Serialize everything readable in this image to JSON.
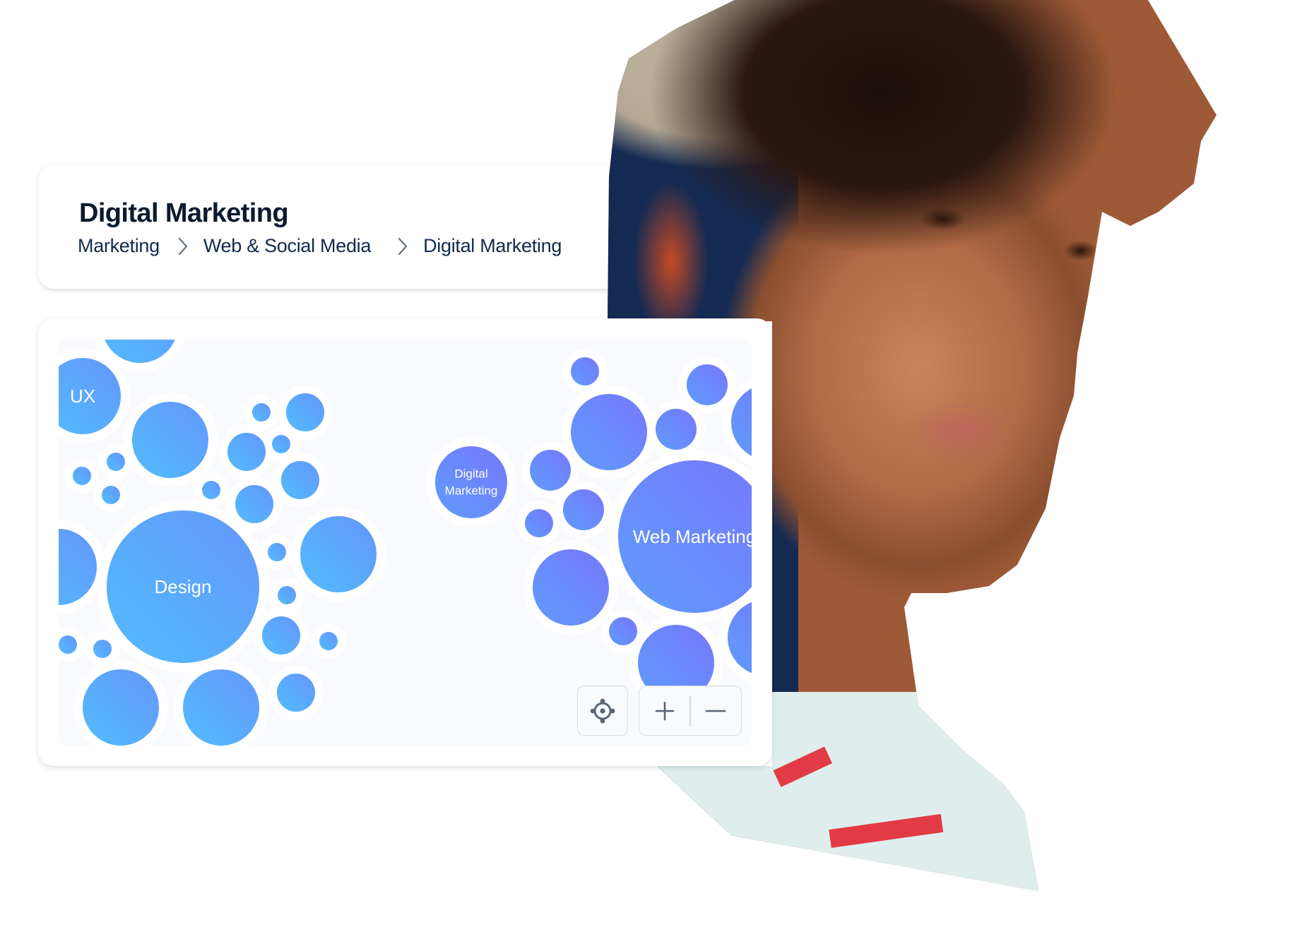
{
  "header": {
    "title": "Digital Marketing",
    "breadcrumb": [
      {
        "label": "Marketing"
      },
      {
        "label": "Web & Social Media"
      },
      {
        "label": "Digital Marketing"
      }
    ],
    "separator_icon": "chevron-right-icon"
  },
  "colors": {
    "title_text": "#0b1a2e",
    "breadcrumb_text": "#102a4c",
    "separator": "#6b7589",
    "chart_background": "#f8fafe",
    "bubble_sky": "#54b7fc",
    "bubble_blue": "#619cfb",
    "bubble_violet": "#7479fb",
    "control_icon": "#5b6577"
  },
  "bubble_map": {
    "clusters": [
      {
        "name": "Design",
        "bubbles": [
          {
            "label": "Design",
            "size": "large",
            "hub": true
          },
          {
            "label": "UX",
            "size": "medium"
          },
          {
            "label": "",
            "size": "medium"
          },
          {
            "label": "",
            "size": "medium"
          },
          {
            "label": "",
            "size": "medium"
          },
          {
            "label": "",
            "size": "medium"
          },
          {
            "label": "",
            "size": "medium"
          },
          {
            "label": "",
            "size": "medium"
          },
          {
            "label": "",
            "size": "small"
          },
          {
            "label": "",
            "size": "small"
          },
          {
            "label": "",
            "size": "small"
          },
          {
            "label": "",
            "size": "small"
          },
          {
            "label": "",
            "size": "small"
          },
          {
            "label": "",
            "size": "small"
          },
          {
            "label": "",
            "size": "tiny"
          },
          {
            "label": "",
            "size": "tiny"
          },
          {
            "label": "",
            "size": "tiny"
          },
          {
            "label": "",
            "size": "tiny"
          },
          {
            "label": "",
            "size": "tiny"
          },
          {
            "label": "",
            "size": "tiny"
          },
          {
            "label": "",
            "size": "tiny"
          },
          {
            "label": "",
            "size": "tiny"
          },
          {
            "label": "",
            "size": "tiny"
          },
          {
            "label": "",
            "size": "tiny"
          },
          {
            "label": "",
            "size": "tiny"
          }
        ]
      },
      {
        "name": "Web Marketing",
        "bubbles": [
          {
            "label": "Web Marketing",
            "size": "large",
            "hub": true
          },
          {
            "label": "Digital Marketing",
            "size": "medium",
            "selected": true
          },
          {
            "label": "",
            "size": "medium"
          },
          {
            "label": "",
            "size": "medium"
          },
          {
            "label": "",
            "size": "medium"
          },
          {
            "label": "",
            "size": "medium"
          },
          {
            "label": "",
            "size": "medium"
          },
          {
            "label": "",
            "size": "small"
          },
          {
            "label": "",
            "size": "small"
          },
          {
            "label": "",
            "size": "small"
          },
          {
            "label": "",
            "size": "small"
          },
          {
            "label": "",
            "size": "tiny"
          },
          {
            "label": "",
            "size": "tiny"
          },
          {
            "label": "",
            "size": "tiny"
          }
        ]
      }
    ]
  },
  "controls": {
    "recenter": {
      "icon": "crosshair-icon",
      "label": "Recenter"
    },
    "zoom_in": {
      "icon": "plus-icon",
      "label": "Zoom in"
    },
    "zoom_out": {
      "icon": "minus-icon",
      "label": "Zoom out"
    }
  }
}
